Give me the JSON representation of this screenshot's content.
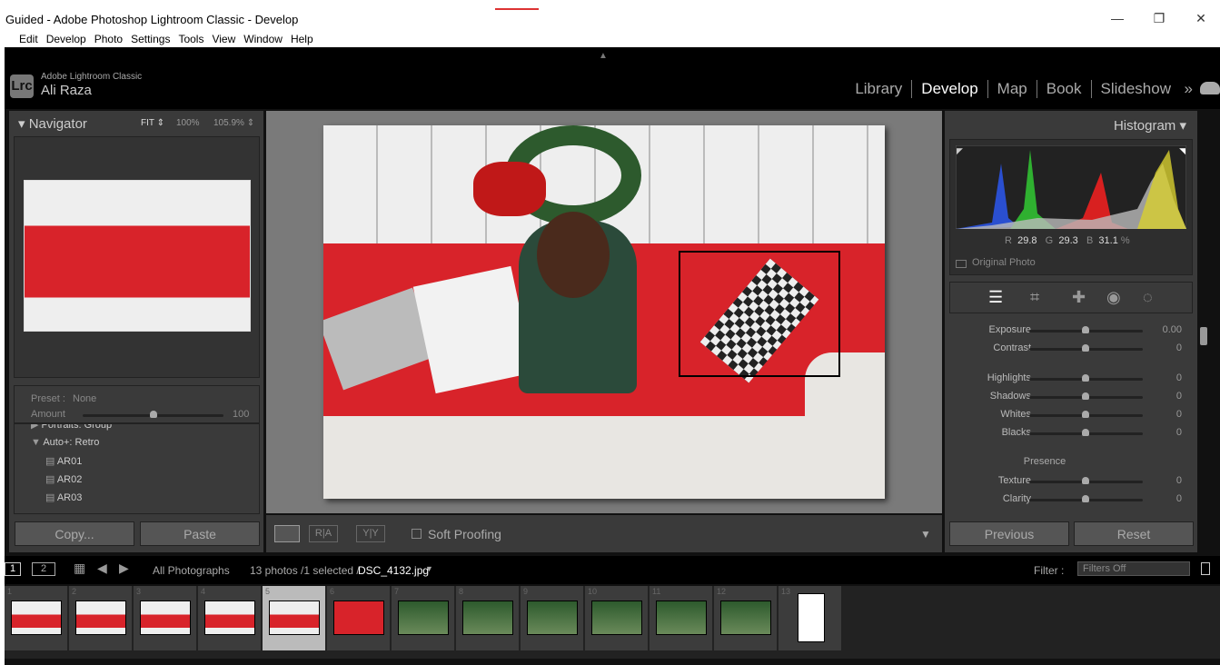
{
  "window": {
    "title": "Guided - Adobe Photoshop Lightroom Classic - Develop",
    "minimize": "—",
    "maximize": "❐",
    "close": "✕"
  },
  "menu": [
    "Edit",
    "Develop",
    "Photo",
    "Settings",
    "Tools",
    "View",
    "Window",
    "Help"
  ],
  "identity": {
    "logo": "Lrc",
    "product": "Adobe Lightroom Classic",
    "user": "Ali Raza"
  },
  "modules": [
    {
      "label": "Library"
    },
    {
      "label": "Develop",
      "active": true
    },
    {
      "label": "Map"
    },
    {
      "label": "Book"
    },
    {
      "label": "Slideshow"
    }
  ],
  "more": "»",
  "navigator": {
    "title": "Navigator",
    "zoom": [
      "FIT ⇕",
      "100%",
      "105.9% ⇕"
    ]
  },
  "presets": {
    "preset_label": "Preset :",
    "preset_value": "None",
    "amount_label": "Amount",
    "amount_value": "100",
    "amount_fraction": 0.5,
    "items": [
      {
        "label": "Portraits: Group",
        "type": "group-collapsed"
      },
      {
        "label": "Auto+: Retro",
        "type": "group-open"
      },
      {
        "label": "AR01"
      },
      {
        "label": "AR02"
      },
      {
        "label": "AR03"
      }
    ]
  },
  "left_buttons": {
    "copy": "Copy...",
    "paste": "Paste"
  },
  "toolbar": {
    "soft_proofing": "Soft Proofing",
    "ra": "R|A",
    "yy": "Y|Y"
  },
  "histogram": {
    "title": "Histogram",
    "r_label": "R",
    "r": "29.8",
    "g_label": "G",
    "g": "29.3",
    "b_label": "B",
    "b": "31.1",
    "pct": "%",
    "original_photo": "Original Photo"
  },
  "tools": [
    "sliders-icon",
    "crop-icon",
    "healing-icon",
    "redeye-icon",
    "mask-icon"
  ],
  "basic": {
    "tone": [
      {
        "name": "Exposure",
        "value": "0.00"
      },
      {
        "name": "Contrast",
        "value": "0"
      }
    ],
    "adjust": [
      {
        "name": "Highlights",
        "value": "0"
      },
      {
        "name": "Shadows",
        "value": "0"
      },
      {
        "name": "Whites",
        "value": "0"
      },
      {
        "name": "Blacks",
        "value": "0"
      }
    ],
    "presence_title": "Presence",
    "presence": [
      {
        "name": "Texture",
        "value": "0"
      },
      {
        "name": "Clarity",
        "value": "0"
      }
    ]
  },
  "right_buttons": {
    "previous": "Previous",
    "reset": "Reset"
  },
  "filmstrip": {
    "view1": "1",
    "view2": "2",
    "source": "All Photographs",
    "count": "13 photos /1 selected /",
    "file": "DSC_4132.jpg",
    "filter_label": "Filter :",
    "filter_value": "Filters Off",
    "thumbs": [
      "1",
      "2",
      "3",
      "4",
      "5",
      "6",
      "7",
      "8",
      "9",
      "10",
      "11",
      "12",
      "13"
    ],
    "selected": "5"
  },
  "colors": {
    "accent_red": "#d8232a",
    "panel": "#3a3a3a",
    "background": "#111111"
  }
}
